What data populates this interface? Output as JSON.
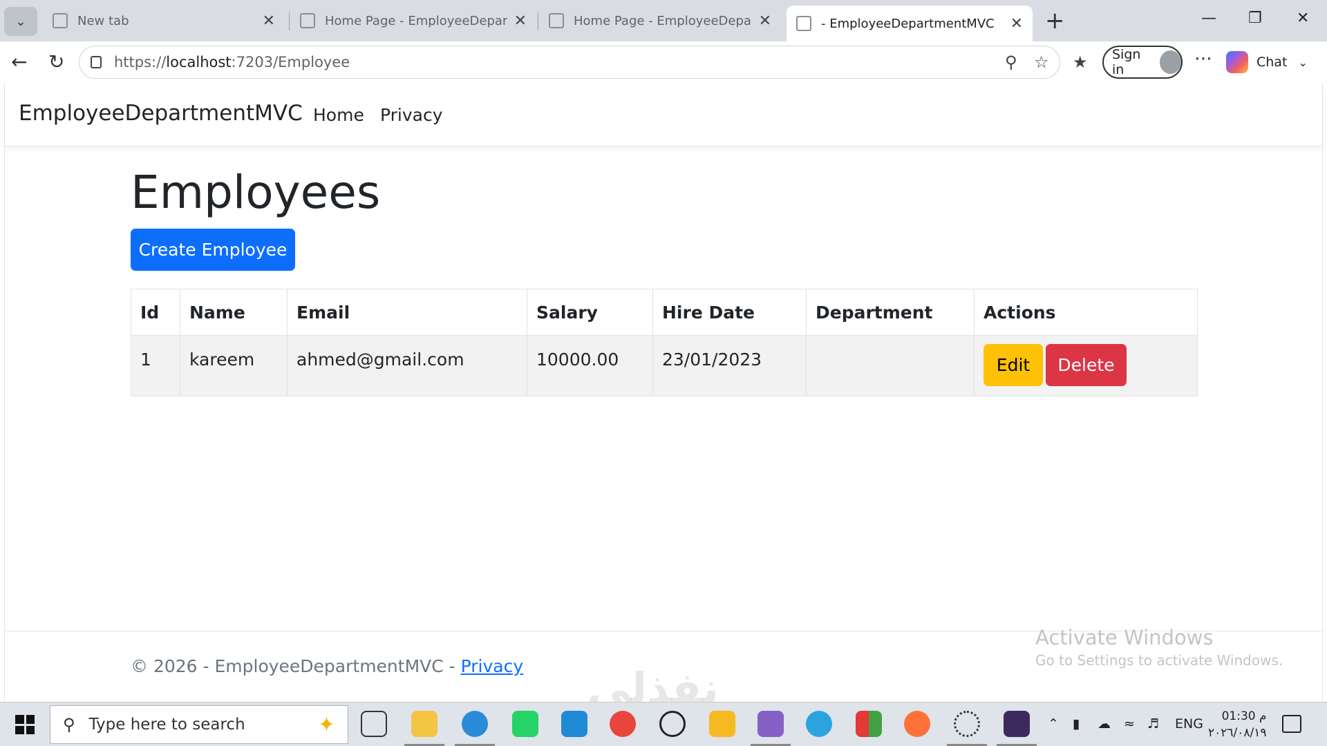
{
  "browser": {
    "tabs": [
      {
        "title": "New tab",
        "active": false
      },
      {
        "title": "Home Page - EmployeeDepartmen",
        "active": false
      },
      {
        "title": "Home Page - EmployeeDepartmen",
        "active": false
      },
      {
        "title": "- EmployeeDepartmentMVC",
        "active": true
      }
    ],
    "url_prefix": "https://",
    "url_host": "localhost",
    "url_rest": ":7203/Employee",
    "sign_in_label": "Sign in",
    "chat_label": "Chat"
  },
  "site": {
    "brand": "EmployeeDepartmentMVC",
    "nav": [
      {
        "label": "Home"
      },
      {
        "label": "Privacy"
      }
    ]
  },
  "page": {
    "title": "Employees",
    "create_button": "Create Employee"
  },
  "table": {
    "columns": [
      "Id",
      "Name",
      "Email",
      "Salary",
      "Hire Date",
      "Department",
      "Actions"
    ],
    "rows": [
      {
        "id": "1",
        "name": "kareem",
        "email": "ahmed@gmail.com",
        "salary": "10000.00",
        "hire_date": "23/01/2023",
        "department": ""
      }
    ],
    "edit_label": "Edit",
    "delete_label": "Delete"
  },
  "footer": {
    "text": "© 2026 - EmployeeDepartmentMVC - ",
    "privacy_link": "Privacy"
  },
  "os": {
    "activate_title": "Activate Windows",
    "activate_sub": "Go to Settings to activate Windows.",
    "search_placeholder": "Type here to search",
    "lang": "ENG",
    "time": "01:30 م",
    "date": "٢٠٢٦/٠٨/١٩",
    "watermark": "نفذلي"
  },
  "colors": {
    "primary": "#0d6efd",
    "warning": "#ffc107",
    "danger": "#dc3545"
  }
}
